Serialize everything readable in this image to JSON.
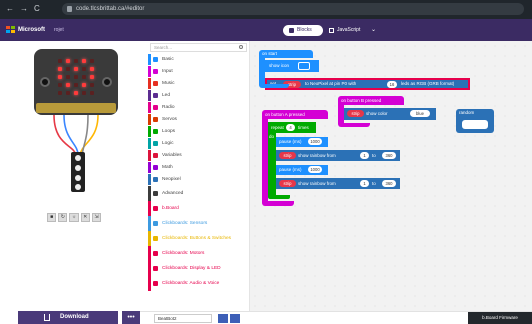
{
  "browser": {
    "back": "←",
    "forward": "→",
    "reload": "C",
    "url": "code.tlcsbrittab.ca/#editor"
  },
  "header": {
    "brand": "Microsoft",
    "project": "rojet",
    "blocks_label": "Blocks",
    "javascript_label": "JavaScript",
    "menu_glyph": "⌄"
  },
  "simulator": {
    "led_on": [
      [
        0,
        1,
        0,
        1,
        0
      ],
      [
        1,
        0,
        1,
        0,
        1
      ],
      [
        1,
        0,
        0,
        0,
        1
      ],
      [
        0,
        1,
        0,
        1,
        0
      ],
      [
        0,
        0,
        1,
        0,
        0
      ]
    ],
    "controls": [
      "■",
      "↻",
      "☼",
      "✕",
      "⇲"
    ]
  },
  "toolbox": {
    "search_placeholder": "Search...",
    "categories": [
      {
        "label": "Basic",
        "color": "#1e90ff"
      },
      {
        "label": "Input",
        "color": "#d400d4"
      },
      {
        "label": "Music",
        "color": "#e63022"
      },
      {
        "label": "Led",
        "color": "#5c2d91"
      },
      {
        "label": "Radio",
        "color": "#e3008c"
      },
      {
        "label": "Servos",
        "color": "#d83b01"
      },
      {
        "label": "Loops",
        "color": "#00aa00"
      },
      {
        "label": "Logic",
        "color": "#00a4a6"
      },
      {
        "label": "Variables",
        "color": "#dc143c"
      },
      {
        "label": "Math",
        "color": "#9400d3"
      },
      {
        "label": "Neopixel",
        "color": "#2b71b6"
      },
      {
        "label": "Advanced",
        "color": "#3c3c3c"
      },
      {
        "label": "b.Board",
        "color": "#e6004c"
      },
      {
        "label": "Clickboards: Sensors",
        "color": "#3c9ae0"
      },
      {
        "label": "Clickboards: Buttons & Switches",
        "color": "#e8b600"
      },
      {
        "label": "Clickboards: Motors",
        "color": "#e6004c"
      },
      {
        "label": "Clickboards: Display & LED",
        "color": "#e6004c"
      },
      {
        "label": "Clickboards: Audio & Voice",
        "color": "#e6004c"
      }
    ]
  },
  "workspace": {
    "on_start": "on start",
    "show_icon": "show icon",
    "set_label": "set",
    "strip_var": "strip",
    "to_neopixel": "to  NeoPixel at pin  P0  with",
    "leds_num": "16",
    "leds_suffix": "leds as  RGB (GRB format)",
    "on_button_b": "on button  B  pressed",
    "show_color": "show color",
    "color_blue": "blue",
    "on_button_a": "on button  A  pressed",
    "repeat": "repeat",
    "repeat_count": "4",
    "times": "times",
    "do": "do",
    "pause": "pause (ms)",
    "pause_val": "1000",
    "show_rainbow": "show rainbow from",
    "to": "to",
    "rainbow_from": "1",
    "rainbow_to": "360",
    "random_label": "random"
  },
  "footer": {
    "download": "Download",
    "more": "•••",
    "project_name": "BeatBot2",
    "firmware": "b.Board Firmware"
  }
}
